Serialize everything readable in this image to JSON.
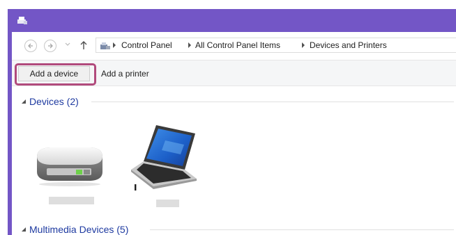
{
  "window": {
    "accent_color": "#7356c6"
  },
  "navigation": {
    "back_icon": "arrow-left-icon",
    "forward_icon": "arrow-right-icon",
    "up_icon": "arrow-up-icon"
  },
  "address": {
    "breadcrumbs": [
      "Control Panel",
      "All Control Panel Items",
      "Devices and Printers"
    ]
  },
  "toolbar": {
    "add_device_label": "Add a device",
    "add_printer_label": "Add a printer",
    "highlight_color": "#b14a7c"
  },
  "groups": {
    "devices": {
      "label": "Devices (2)",
      "items": [
        {
          "icon": "hard-drive-icon"
        },
        {
          "icon": "laptop-warning-icon"
        }
      ]
    },
    "multimedia": {
      "label": "Multimedia Devices (5)"
    }
  }
}
